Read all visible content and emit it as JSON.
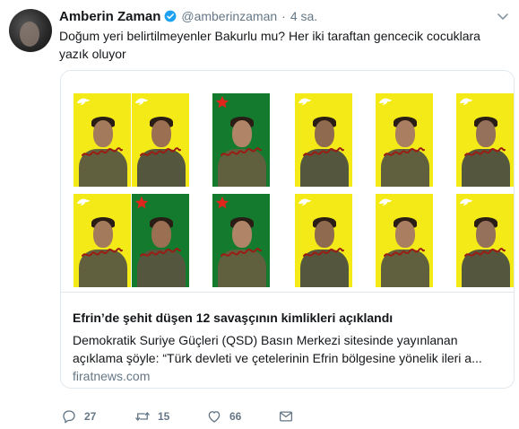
{
  "tweet": {
    "author_name": "Amberin Zaman",
    "handle": "@amberinzaman",
    "separator": "·",
    "time": "4 sa.",
    "text": "Doğum yeri belirtilmeyenler Bakurlu mu? Her iki taraftan gencecik cocuklara yazık oluyor",
    "verified": true
  },
  "card": {
    "title": "Efrin’de şehit düşen 12 savaşçının kimlikleri açıklandı",
    "description_line1": "Demokratik Suriye Güçleri (QSD) Basın Merkezi sitesinde yayınlanan",
    "description_line2": "açıklama şöyle: “Türk devleti ve çetelerinin Efrin bölgesine yönelik ileri a...",
    "domain": "firatnews.com",
    "photos": [
      {
        "bg": "yellow"
      },
      {
        "bg": "yellow"
      },
      {
        "bg": "green"
      },
      {
        "bg": "yellow"
      },
      {
        "bg": "yellow"
      },
      {
        "bg": "yellow"
      },
      {
        "bg": "yellow"
      },
      {
        "bg": "green"
      },
      {
        "bg": "green"
      },
      {
        "bg": "yellow"
      },
      {
        "bg": "yellow"
      },
      {
        "bg": "yellow"
      }
    ]
  },
  "actions": {
    "reply_icon": "reply-icon",
    "reply_count": "27",
    "retweet_icon": "retweet-icon",
    "retweet_count": "15",
    "like_icon": "heart-icon",
    "like_count": "66",
    "dm_icon": "envelope-icon"
  },
  "colors": {
    "text": "#14171a",
    "secondary": "#657786",
    "border": "#e1e8ed",
    "verified": "#1da1f2",
    "poster_yellow": "#f3ea18",
    "poster_green": "#137a2e",
    "star_red": "#e0261c"
  }
}
